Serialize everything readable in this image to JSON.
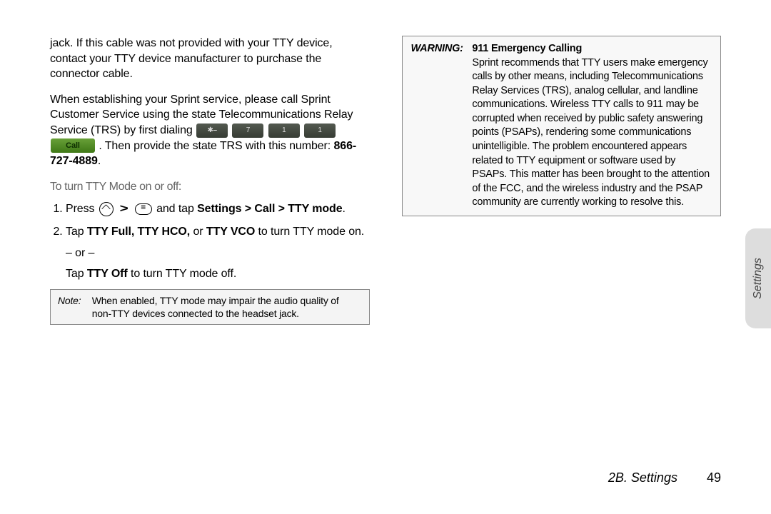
{
  "left": {
    "para1": "jack. If this cable was not provided with your TTY device, contact your TTY device manufacturer to purchase the connector cable.",
    "para2_a": "When establishing your Sprint service, please call Sprint Customer Service using the state Telecommunications Relay Service (TRS) by first dialing ",
    "para2_b": ". Then provide the state TRS with this number: ",
    "trs_number": "866-727-4889",
    "subhead": "To turn TTY Mode on or off:",
    "step1_a": "Press ",
    "step1_b": " and tap ",
    "step1_path": "Settings > Call > TTY mode",
    "step2_a": "Tap ",
    "step2_opts": "TTY Full, TTY HCO,",
    "step2_or": " or ",
    "step2_vco": "TTY VCO",
    "step2_b": " to turn TTY mode on.",
    "ordash": "– or –",
    "step2_c": "Tap ",
    "step2_off": "TTY Off",
    "step2_d": " to turn TTY mode off.",
    "note_label": "Note:",
    "note_body": "When enabled, TTY mode may impair the audio quality of non-TTY devices connected to the headset jack."
  },
  "buttons": {
    "call_label": "Call"
  },
  "right": {
    "warn_label": "WARNING:",
    "warn_header": "911 Emergency Calling",
    "warn_body": "Sprint recommends that TTY users make emergency calls by other means, including Telecommunications Relay Services (TRS), analog cellular, and landline communications. Wireless TTY calls to 911 may be corrupted when received by public safety answering points (PSAPs), rendering some communications unintelligible. The problem encountered appears related to TTY equipment or software used by PSAPs. This matter has been brought to the attention of the FCC, and the wireless industry and the PSAP community are currently working to resolve this."
  },
  "side_tab": "Settings",
  "footer_section": "2B. Settings",
  "page_number": "49"
}
